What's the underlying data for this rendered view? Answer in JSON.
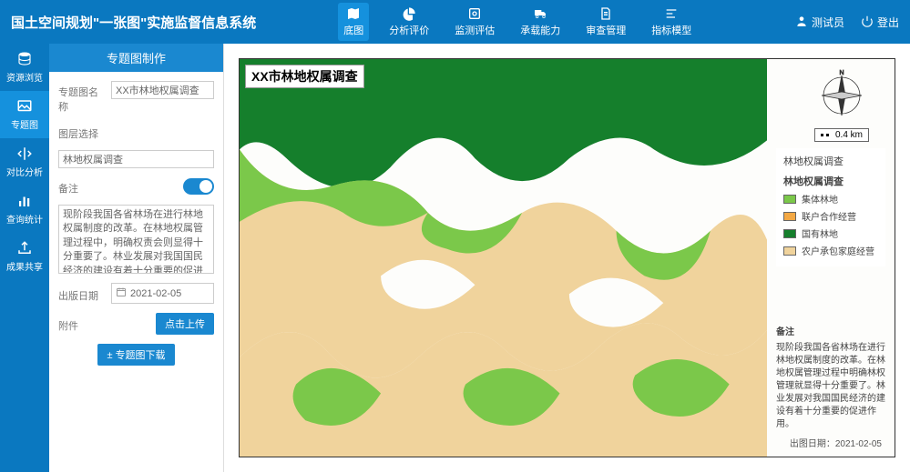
{
  "header": {
    "title": "国土空间规划\"一张图\"实施监督信息系统",
    "nav": [
      {
        "label": "底图",
        "active": true
      },
      {
        "label": "分析评价",
        "active": false
      },
      {
        "label": "监测评估",
        "active": false
      },
      {
        "label": "承载能力",
        "active": false
      },
      {
        "label": "审查管理",
        "active": false
      },
      {
        "label": "指标模型",
        "active": false
      }
    ],
    "user": "测试员",
    "logout": "登出"
  },
  "sidebar": [
    {
      "label": "资源浏览",
      "active": false
    },
    {
      "label": "专题图",
      "active": true
    },
    {
      "label": "对比分析",
      "active": false
    },
    {
      "label": "查询统计",
      "active": false
    },
    {
      "label": "成果共享",
      "active": false
    }
  ],
  "form": {
    "panel_title": "专题图制作",
    "fields": {
      "name_label": "专题图名称",
      "name_value": "XX市林地权属调查",
      "layer_label": "图层选择",
      "layer_value": "林地权属调查",
      "remark_label": "备注",
      "remark_value": "现阶段我国各省林场在进行林地权属制度的改革。在林地权属管理过程中，明确权责会则显得十分重要了。林业发展对我国国民经济的建设有着十分重要的促进作用。",
      "date_label": "出版日期",
      "date_value": "2021-02-05",
      "attachment_label": "附件",
      "upload_btn": "点击上传",
      "download_btn": "± 专题图下载"
    }
  },
  "map": {
    "title": "XX市林地权属调查",
    "scale": "0.4 km",
    "legend_group": "林地权属调查",
    "legend_title": "林地权属调查",
    "legend_items": [
      {
        "label": "集体林地",
        "color": "#7bc84a"
      },
      {
        "label": "联户合作经营",
        "color": "#f3a844"
      },
      {
        "label": "国有林地",
        "color": "#157f2c"
      },
      {
        "label": "农户承包家庭经营",
        "color": "#f0d39c"
      }
    ],
    "notes_title": "备注",
    "notes_text": "现阶段我国各省林场在进行林地权属制度的改革。在林地权属管理过程中明确林权管理就显得十分重要了。林业发展对我国国民经济的建设有着十分重要的促进作用。",
    "date_label": "出图日期：",
    "date_value": "2021-02-05"
  }
}
